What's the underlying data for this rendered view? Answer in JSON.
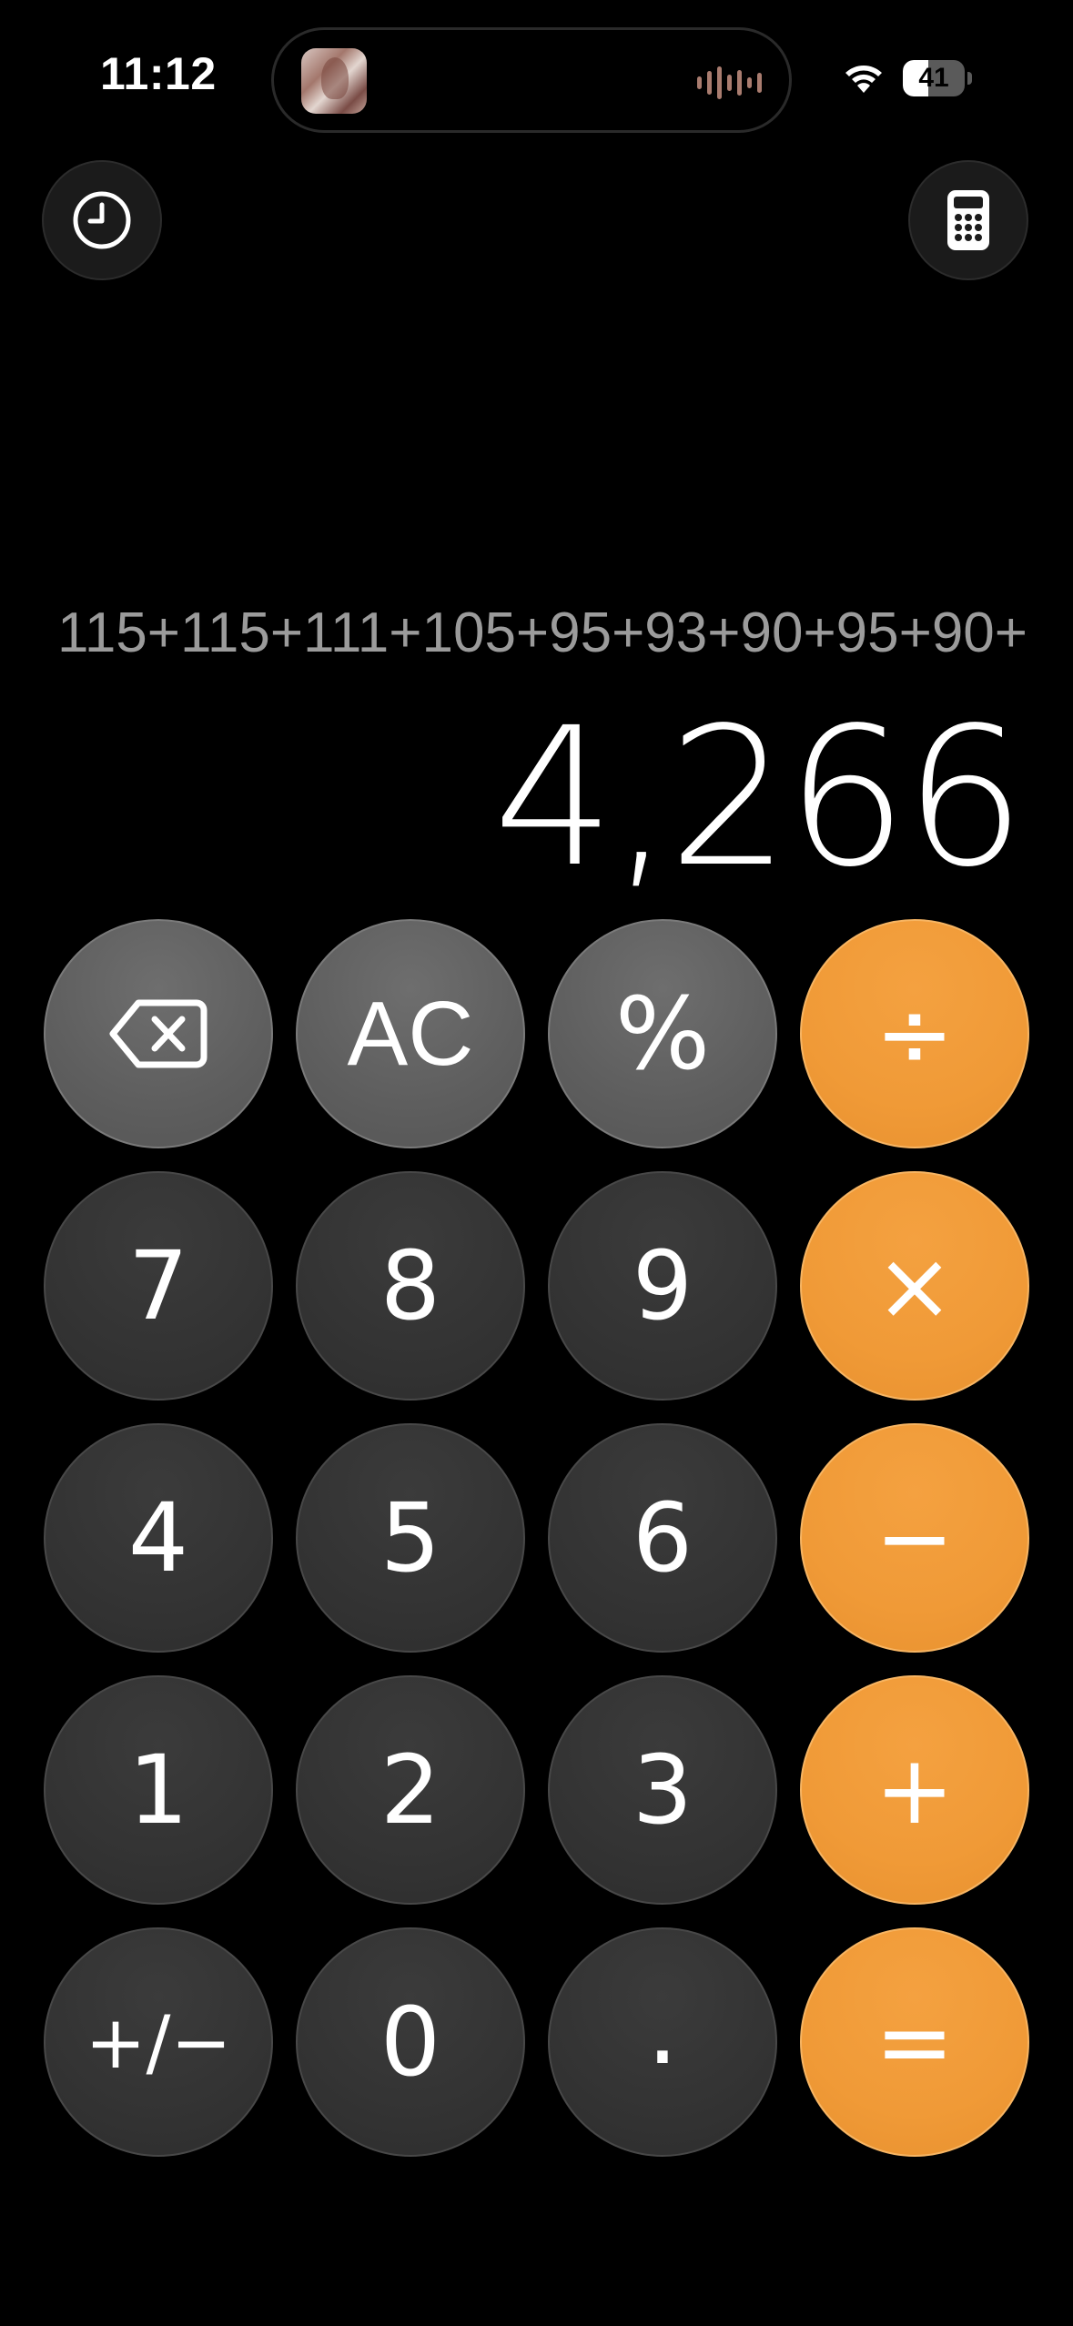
{
  "status_bar": {
    "time": "11:12",
    "battery_level": "41",
    "icons": [
      "now-playing-artwork",
      "audio-wave-icon",
      "wifi-icon",
      "battery-icon"
    ]
  },
  "toolbar": {
    "history_icon": "clock-icon",
    "mode_icon": "calculator-icon"
  },
  "display": {
    "expression": "115+115+111+105+95+93+90+95+90+",
    "result": "4,266"
  },
  "keypad": {
    "backspace_icon": "backspace-icon",
    "clear_label": "AC",
    "percent_label": "%",
    "divide_label": "÷",
    "seven": "7",
    "eight": "8",
    "nine": "9",
    "multiply_label": "×",
    "four": "4",
    "five": "5",
    "six": "6",
    "minus_label": "−",
    "one": "1",
    "two": "2",
    "three": "3",
    "plus_label": "+",
    "plus_minus_label": "+/−",
    "zero": "0",
    "decimal_label": ".",
    "equals_label": "="
  },
  "colors": {
    "background": "#000000",
    "operator_orange": "#f09a37",
    "function_gray": "#5e5e5e",
    "number_dark": "#333333"
  }
}
